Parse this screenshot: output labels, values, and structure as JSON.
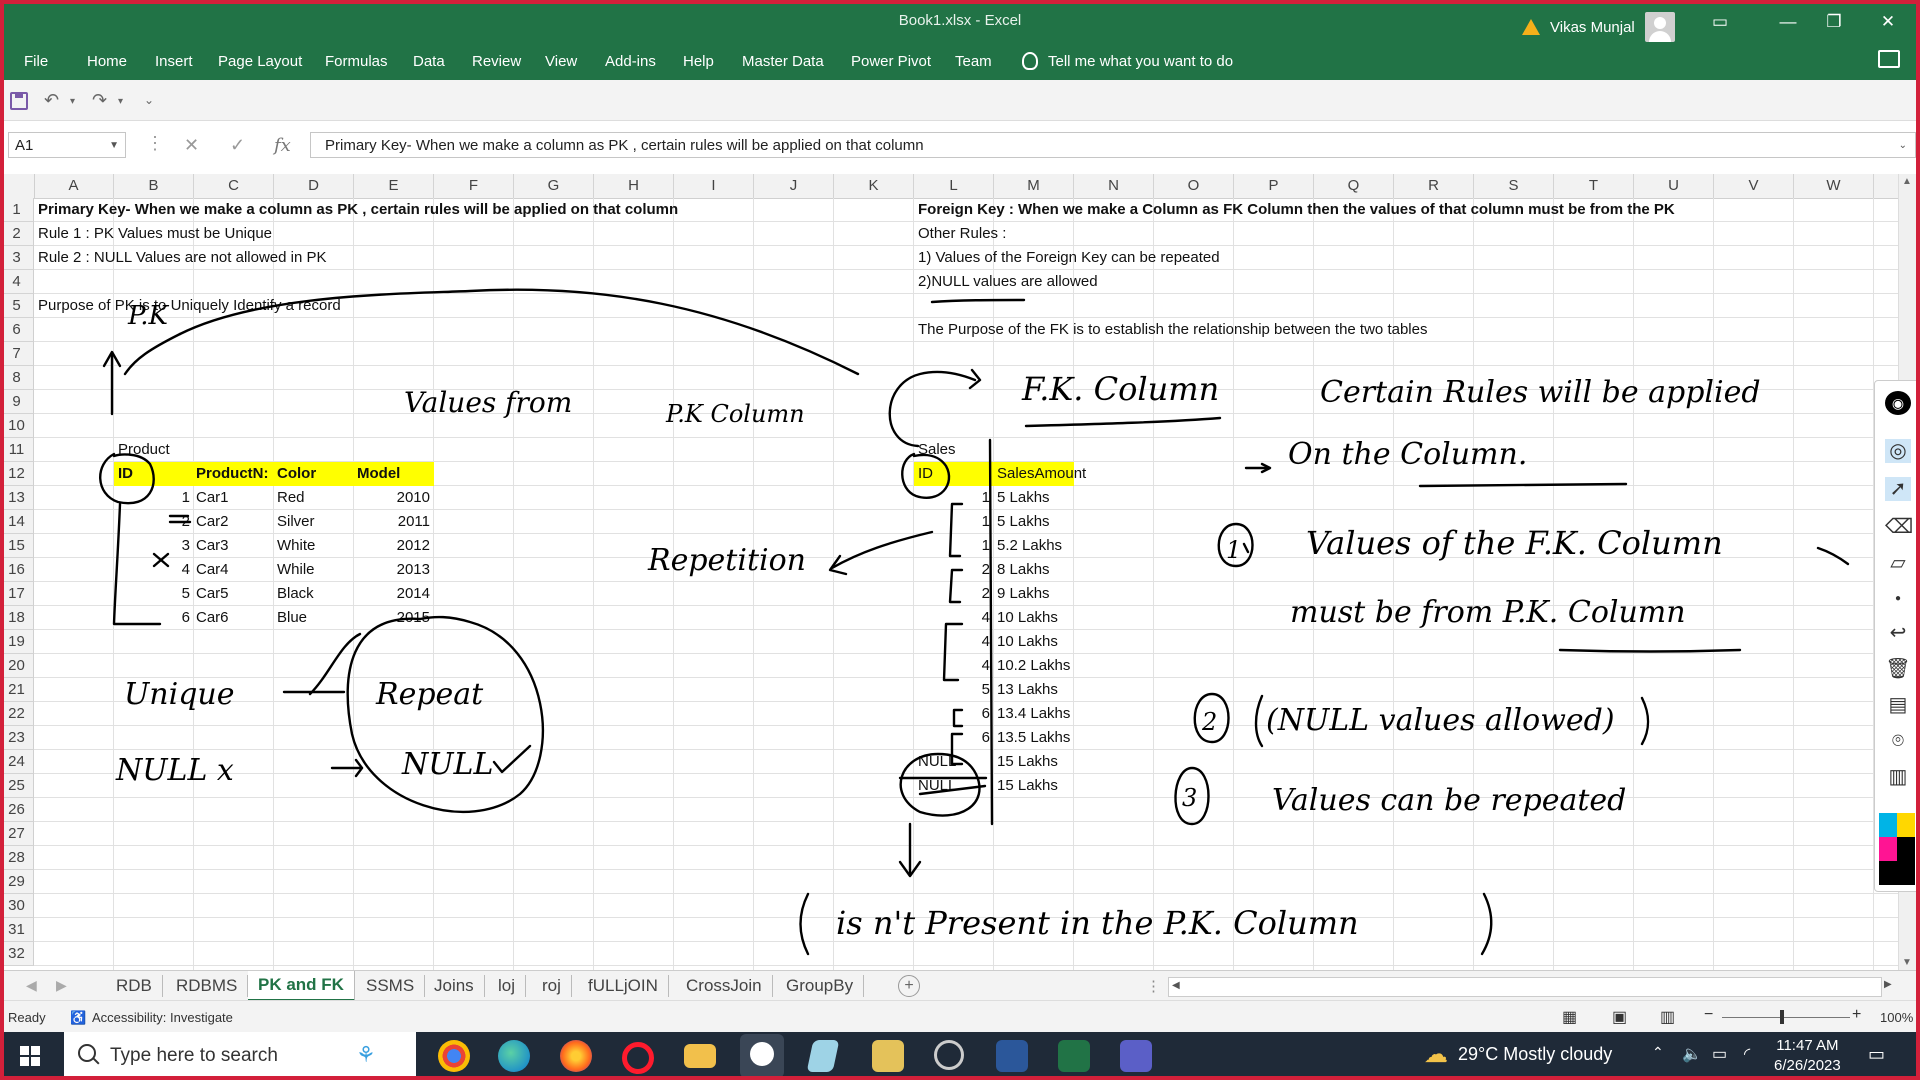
{
  "window": {
    "title": "Book1.xlsx  -  Excel",
    "user": "Vikas Munjal"
  },
  "ribbon": {
    "tabs": [
      "File",
      "Home",
      "Insert",
      "Page Layout",
      "Formulas",
      "Data",
      "Review",
      "View",
      "Add-ins",
      "Help",
      "Master Data",
      "Power Pivot",
      "Team"
    ],
    "tell_me": "Tell me what you want to do"
  },
  "formula_bar": {
    "name_box": "A1",
    "formula": "Primary Key-   When we make a column as PK , certain rules will be applied on that column"
  },
  "columns": [
    "A",
    "B",
    "C",
    "D",
    "E",
    "F",
    "G",
    "H",
    "I",
    "J",
    "K",
    "L",
    "M",
    "N",
    "O",
    "P",
    "Q",
    "R",
    "S",
    "T",
    "U",
    "V",
    "W"
  ],
  "rows": [
    "1",
    "2",
    "3",
    "4",
    "5",
    "6",
    "7",
    "8",
    "9",
    "10",
    "11",
    "12",
    "13",
    "14",
    "15",
    "16",
    "17",
    "18",
    "19",
    "20",
    "21",
    "22",
    "23",
    "24",
    "25",
    "26",
    "27",
    "28",
    "29",
    "30",
    "31",
    "32"
  ],
  "cells": {
    "A1": "Primary Key-   When we make a column as PK , certain rules will be applied on that column",
    "A2": "Rule 1 :  PK Values must be Unique",
    "A3": "Rule 2 : NULL Values are not allowed in PK",
    "A5": "Purpose of PK is to Uniquely Identify a record",
    "A11": "Product",
    "L1": "Foreign Key : When we make a Column as FK Column then the values of that column must be from the PK",
    "L2": "Other Rules :",
    "L3": "1) Values of the Foreign Key can be repeated",
    "L4": "2)NULL values are allowed",
    "L6": "The Purpose of the FK is to establish the relationship between the two tables",
    "L11": "Sales"
  },
  "product_table": {
    "headers": [
      "ID",
      "ProductN:",
      "Color",
      "Model"
    ],
    "rows": [
      [
        "1",
        "Car1",
        "Red",
        "2010"
      ],
      [
        "2",
        "Car2",
        "Silver",
        "2011"
      ],
      [
        "3",
        "Car3",
        "White",
        "2012"
      ],
      [
        "4",
        "Car4",
        "While",
        "2013"
      ],
      [
        "5",
        "Car5",
        "Black",
        "2014"
      ],
      [
        "6",
        "Car6",
        "Blue",
        "2015"
      ]
    ]
  },
  "sales_table": {
    "headers": [
      "ID",
      "SalesAmount"
    ],
    "rows": [
      [
        "1",
        "5 Lakhs"
      ],
      [
        "1",
        "5 Lakhs"
      ],
      [
        "1",
        "5.2 Lakhs"
      ],
      [
        "2",
        "8 Lakhs"
      ],
      [
        "2",
        "9 Lakhs"
      ],
      [
        "4",
        "10 Lakhs"
      ],
      [
        "4",
        "10 Lakhs"
      ],
      [
        "4",
        "10.2 Lakhs"
      ],
      [
        "5",
        "13 Lakhs"
      ],
      [
        "6",
        "13.4 Lakhs"
      ],
      [
        "6",
        "13.5 Lakhs"
      ],
      [
        "NULL",
        "15 Lakhs"
      ],
      [
        "NULL",
        "15 Lakhs"
      ]
    ]
  },
  "annotations": {
    "pk": "P.K",
    "values_from": "Values from",
    "pk_column": "P.K Column",
    "repetition": "Repetition",
    "unique": "Unique",
    "null_x": "NULL x",
    "repeat": "Repeat",
    "null_check": "NULL",
    "fk_column": "F.K. Column",
    "certain_rules": "Certain Rules will be applied",
    "on_the_column": "On the Column.",
    "rule1_a": "Values of the F.K. Column",
    "rule1_b": "must be from P.K. Column",
    "rule2": "(NULL values allowed)",
    "rule3": "Values can be repeated",
    "not_present": "is n't Present in the P.K. Column",
    "num1": "1",
    "num2": "2",
    "num3": "3"
  },
  "sheet_tabs": [
    "RDB",
    "RDBMS",
    "PK and FK",
    "SSMS",
    "Joins",
    "loj",
    "roj",
    "fULLjOIN",
    "CrossJoin",
    "GroupBy"
  ],
  "active_sheet": "PK and FK",
  "status": {
    "ready": "Ready",
    "accessibility": "Accessibility: Investigate",
    "zoom": "100%"
  },
  "taskbar": {
    "search_placeholder": "Type here to search",
    "weather": "29°C  Mostly cloudy",
    "time": "11:47 AM",
    "date": "6/26/2023"
  },
  "colors": {
    "excel_green": "#217346",
    "highlight_yellow": "#ffff00",
    "taskbar": "#1f2a38"
  }
}
